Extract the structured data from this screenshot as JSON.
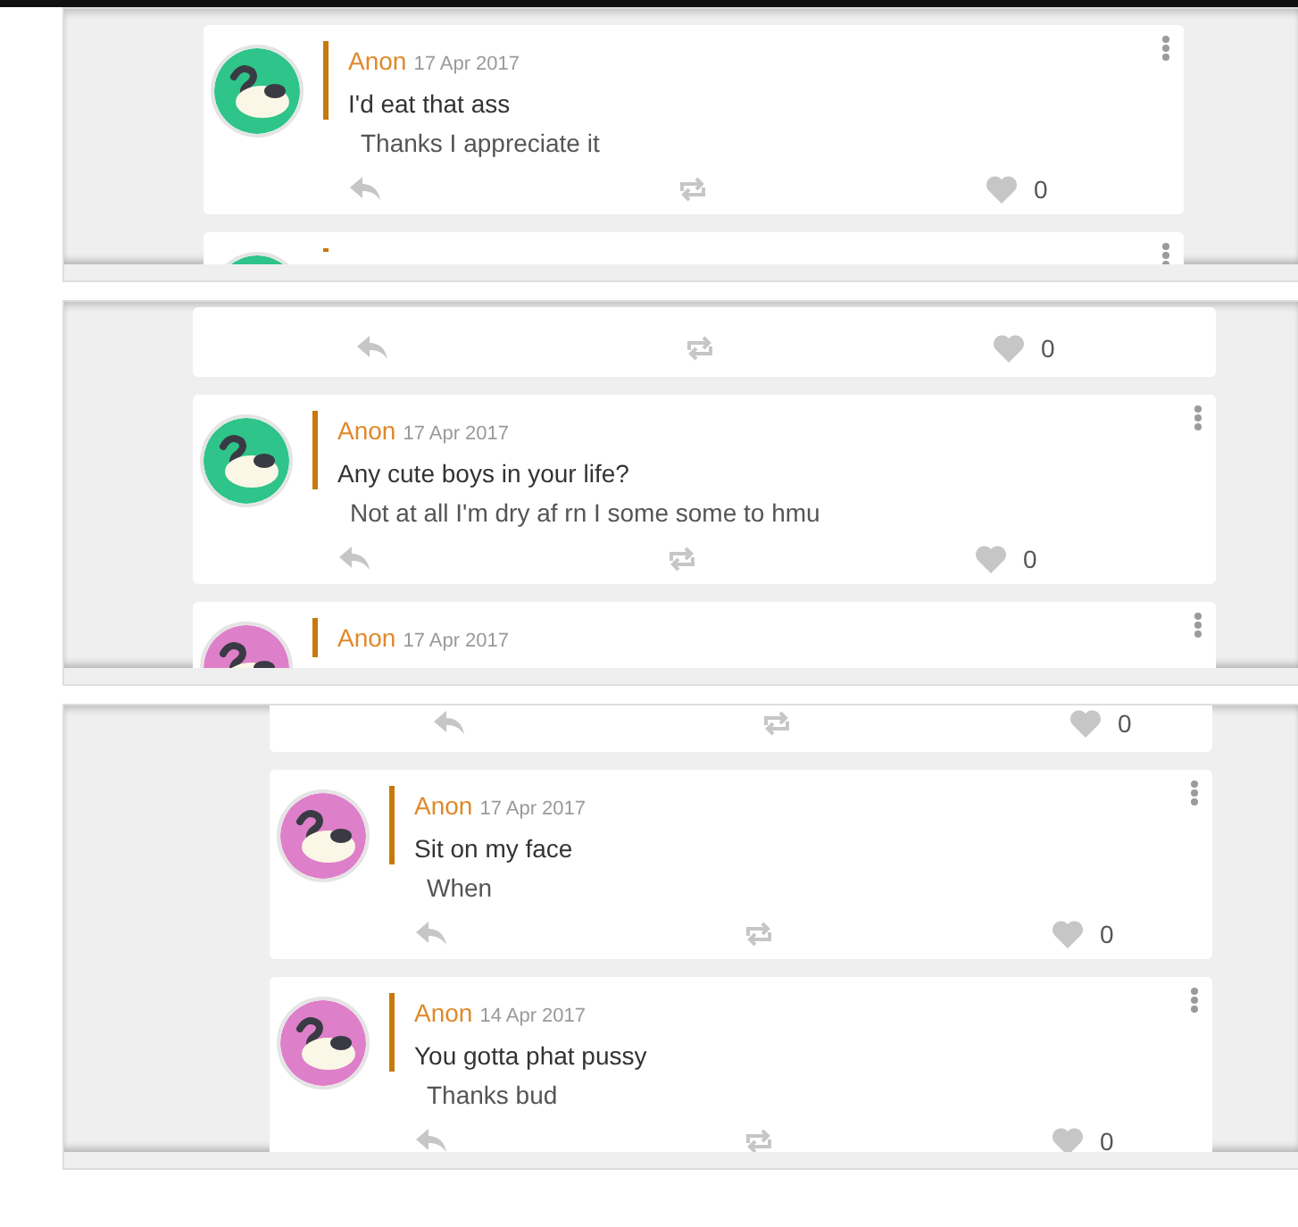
{
  "panels": [
    {
      "cards": [
        {
          "kind": "full",
          "author": "Anon",
          "date": "17 Apr 2017",
          "question": "I'd eat that ass",
          "answer": "Thanks I appreciate it",
          "likes": "0",
          "color": "#2ec48a"
        },
        {
          "kind": "header_cut",
          "color": "#2ec48a"
        }
      ]
    },
    {
      "cards": [
        {
          "kind": "actions",
          "likes": "0"
        },
        {
          "kind": "full",
          "author": "Anon",
          "date": "17 Apr 2017",
          "question": "Any cute boys in your life?",
          "answer": "Not at all I'm dry af rn I some some to hmu",
          "likes": "0",
          "color": "#2ec48a"
        },
        {
          "kind": "header",
          "author": "Anon",
          "date": "17 Apr 2017",
          "color": "#de7fc9"
        }
      ]
    },
    {
      "cards": [
        {
          "kind": "actions",
          "likes": "0"
        },
        {
          "kind": "full",
          "author": "Anon",
          "date": "17 Apr 2017",
          "question": "Sit on my face",
          "answer": "When",
          "likes": "0",
          "color": "#de7fc9"
        },
        {
          "kind": "full",
          "author": "Anon",
          "date": "14 Apr 2017",
          "question": "You gotta phat pussy",
          "answer": "Thanks bud",
          "likes": "0",
          "color": "#de7fc9"
        }
      ]
    }
  ]
}
